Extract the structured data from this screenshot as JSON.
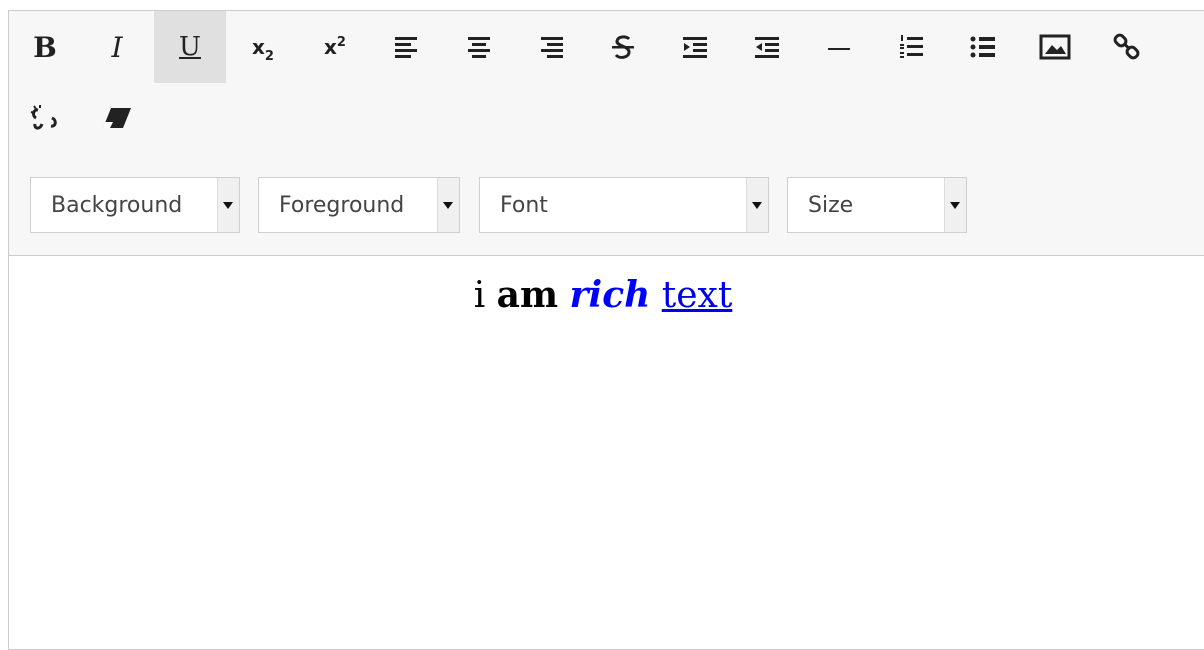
{
  "toolbar": {
    "buttons_row1": [
      {
        "name": "bold-button",
        "icon": "bold-icon",
        "glyph": "B",
        "active": false
      },
      {
        "name": "italic-button",
        "icon": "italic-icon",
        "glyph": "I",
        "active": false
      },
      {
        "name": "underline-button",
        "icon": "underline-icon",
        "glyph": "U",
        "active": true
      },
      {
        "name": "subscript-button",
        "icon": "subscript-icon",
        "glyph": "x",
        "glyph_small": "2"
      },
      {
        "name": "superscript-button",
        "icon": "superscript-icon",
        "glyph": "x",
        "glyph_small": "2"
      },
      {
        "name": "align-left-button",
        "icon": "align-left-icon"
      },
      {
        "name": "align-center-button",
        "icon": "align-center-icon"
      },
      {
        "name": "align-right-button",
        "icon": "align-right-icon"
      },
      {
        "name": "strikethrough-button",
        "icon": "strikethrough-icon"
      },
      {
        "name": "indent-button",
        "icon": "indent-icon"
      },
      {
        "name": "outdent-button",
        "icon": "outdent-icon"
      },
      {
        "name": "horizontal-rule-button",
        "icon": "horizontal-rule-icon"
      },
      {
        "name": "ordered-list-button",
        "icon": "ordered-list-icon"
      },
      {
        "name": "unordered-list-button",
        "icon": "unordered-list-icon"
      },
      {
        "name": "insert-image-button",
        "icon": "image-icon"
      },
      {
        "name": "insert-link-button",
        "icon": "link-icon"
      }
    ],
    "buttons_row2": [
      {
        "name": "unlink-button",
        "icon": "unlink-icon"
      },
      {
        "name": "clear-format-button",
        "icon": "eraser-icon"
      }
    ],
    "selects": {
      "background": "Background",
      "foreground": "Foreground",
      "font": "Font",
      "size": "Size"
    }
  },
  "content": {
    "plain": "i",
    "bold": "am",
    "bold_italic_colored": "rich",
    "link": "text"
  },
  "colors": {
    "toolbar_bg": "#f7f7f7",
    "active_button_bg": "#e0e0e0",
    "rich_text_color": "#0000ff",
    "link_color": "#0000ee"
  }
}
